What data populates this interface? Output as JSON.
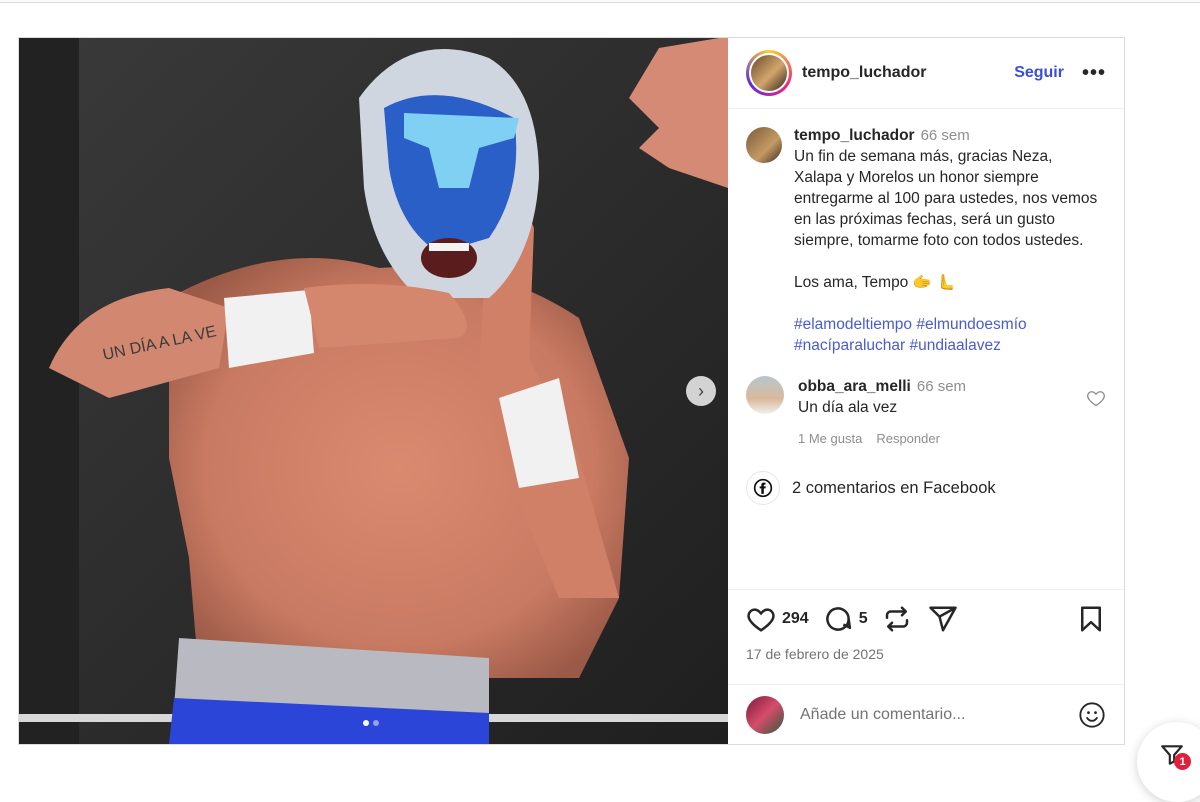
{
  "post": {
    "username": "tempo_luchador",
    "follow_label": "Seguir",
    "more_label": "•••",
    "caption": {
      "username": "tempo_luchador",
      "time": "66 sem",
      "text": "Un fin de semana más, gracias Neza, Xalapa y Morelos un honor siempre entregarme al 100 para ustedes, nos vemos en las próximas fechas, será un gusto siempre, tomarme foto con todos ustedes.",
      "signoff": "Los ama, Tempo 🫱 🫷",
      "hashtags": "#elamodeltiempo #elmundoesmío #nacíparaluchar #undiaalavez"
    },
    "photo_tattoo_text": "UN DÍA A LA VE",
    "comments": [
      {
        "username": "obba_ara_melli",
        "time": "66 sem",
        "text": "Un día ala vez",
        "likes_label": "1 Me gusta",
        "reply_label": "Responder"
      }
    ],
    "facebook_comments_label": "2 comentarios en Facebook",
    "likes_count": "294",
    "comments_count": "5",
    "date": "17 de febrero de 2025",
    "add_comment_placeholder": "Añade un comentario...",
    "carousel": {
      "pages": 2,
      "current": 1
    }
  },
  "filter_badge": "1",
  "icons": [
    "ellipsis-icon",
    "heart-icon",
    "comment-icon",
    "repost-icon",
    "share-icon",
    "bookmark-icon",
    "emoji-icon",
    "facebook-icon",
    "chevron-right-icon",
    "filter-icon"
  ],
  "colors": {
    "link": "#3a4fd6",
    "badge": "#e0203a"
  }
}
